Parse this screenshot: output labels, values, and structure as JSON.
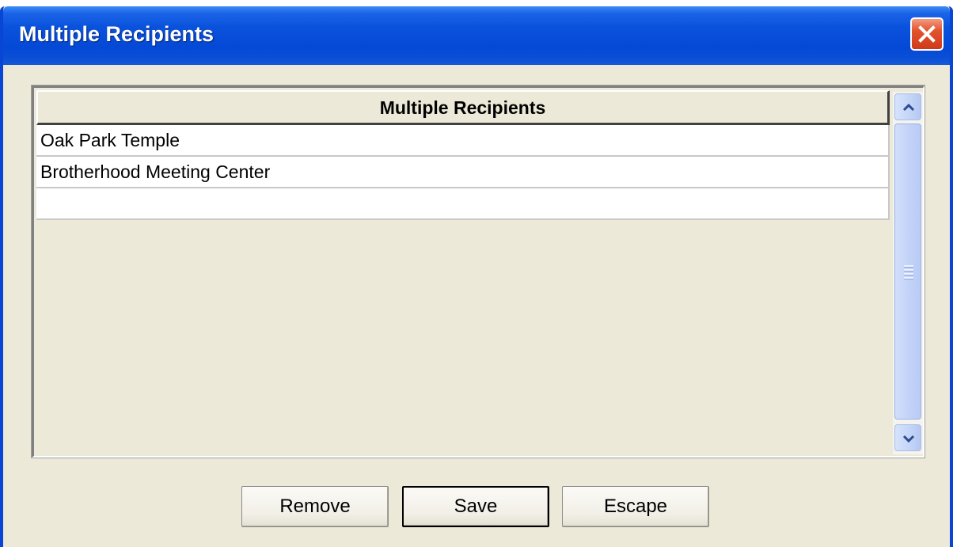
{
  "window": {
    "title": "Multiple Recipients"
  },
  "grid": {
    "column_header": "Multiple Recipients",
    "rows": [
      "Oak Park Temple",
      "Brotherhood Meeting Center",
      ""
    ]
  },
  "buttons": {
    "remove": "Remove",
    "save": "Save",
    "escape": "Escape"
  },
  "colors": {
    "titlebar": "#0a52dc",
    "dialog_background": "#ece9d8",
    "close_button": "#e2522e",
    "scrollbar": "#c3d4f7"
  },
  "icons": {
    "close": "close-icon",
    "scroll_up": "chevron-up-icon",
    "scroll_down": "chevron-down-icon",
    "scroll_grip": "grip-icon"
  }
}
